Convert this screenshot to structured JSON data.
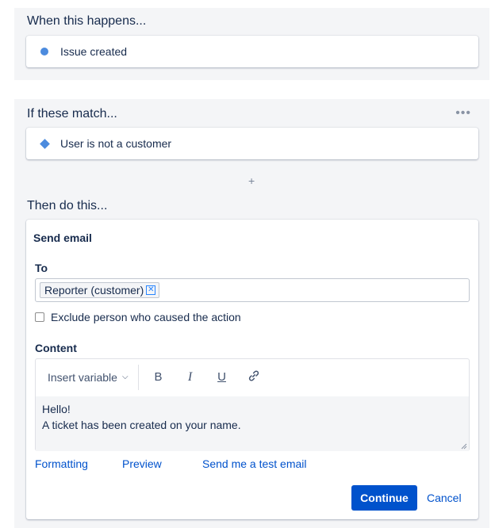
{
  "trigger": {
    "heading": "When this happens...",
    "item_label": "Issue created"
  },
  "condition": {
    "heading": "If these match...",
    "more_label": "•••",
    "item_label": "User is not a customer",
    "add_label": "+"
  },
  "action": {
    "heading": "Then do this...",
    "title": "Send email",
    "to_label": "To",
    "to_chips": [
      "Reporter (customer)"
    ],
    "chip_remove_glyph": "✕",
    "exclude_label": "Exclude person who caused the action",
    "exclude_checked": false,
    "content_label": "Content",
    "toolbar": {
      "insert_variable": "Insert variable",
      "bold": "B",
      "italic": "I",
      "underline": "U"
    },
    "body_lines": [
      "Hello!",
      "A ticket has been created on your name."
    ],
    "links": {
      "formatting": "Formatting",
      "preview": "Preview",
      "test_email": "Send me a test email"
    },
    "continue_label": "Continue",
    "cancel_label": "Cancel"
  },
  "colors": {
    "accent": "#0052cc",
    "icon_blue": "#4c8bde",
    "panel_bg": "#f4f5f7"
  }
}
